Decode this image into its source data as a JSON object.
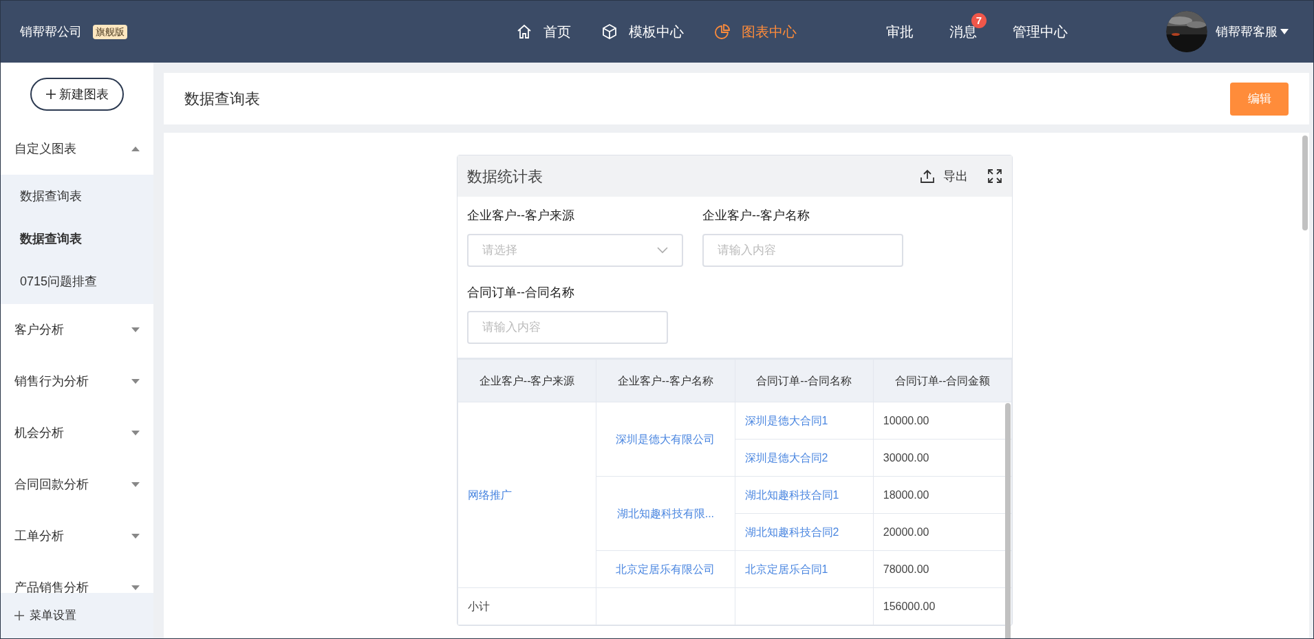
{
  "header": {
    "company": "销帮帮公司",
    "edition_badge": "旗舰版",
    "nav": [
      {
        "label": "首页",
        "selected": false
      },
      {
        "label": "模板中心",
        "selected": false
      },
      {
        "label": "图表中心",
        "selected": true
      }
    ],
    "links": [
      {
        "label": "审批"
      },
      {
        "label": "消息",
        "badge": "7"
      },
      {
        "label": "管理中心"
      }
    ],
    "user": {
      "name": "销帮帮客服"
    }
  },
  "sidebar": {
    "new_button": "新建图表",
    "groups": [
      {
        "label": "自定义图表",
        "expanded": true,
        "children": [
          {
            "label": "数据查询表",
            "selected": false
          },
          {
            "label": "数据查询表",
            "selected": true
          },
          {
            "label": "0715问题排查",
            "selected": false
          }
        ]
      },
      {
        "label": "客户分析",
        "expanded": false
      },
      {
        "label": "销售行为分析",
        "expanded": false
      },
      {
        "label": "机会分析",
        "expanded": false
      },
      {
        "label": "合同回款分析",
        "expanded": false
      },
      {
        "label": "工单分析",
        "expanded": false
      },
      {
        "label": "产品销售分析",
        "expanded": false
      }
    ],
    "footer": "菜单设置"
  },
  "page": {
    "title": "数据查询表",
    "edit_button": "编辑"
  },
  "widget": {
    "title": "数据统计表",
    "export": "导出",
    "filters": [
      {
        "label": "企业客户--客户来源",
        "kind": "select",
        "placeholder": "请选择"
      },
      {
        "label": "企业客户--客户名称",
        "kind": "text",
        "placeholder": "请输入内容"
      },
      {
        "label": "合同订单--合同名称",
        "kind": "text",
        "placeholder": "请输入内容"
      }
    ],
    "table": {
      "columns": [
        "企业客户--客户来源",
        "企业客户--客户名称",
        "合同订单--合同名称",
        "合同订单--合同金额"
      ],
      "groups": [
        {
          "source": "网络推广",
          "customers": [
            {
              "name": "深圳是德大有限公司",
              "contracts": [
                {
                  "name": "深圳是德大合同1",
                  "amount": "10000.00"
                },
                {
                  "name": "深圳是德大合同2",
                  "amount": "30000.00"
                }
              ]
            },
            {
              "name": "湖北知趣科技有限...",
              "contracts": [
                {
                  "name": "湖北知趣科技合同1",
                  "amount": "18000.00"
                },
                {
                  "name": "湖北知趣科技合同2",
                  "amount": "20000.00"
                }
              ]
            },
            {
              "name": "北京定居乐有限公司",
              "contracts": [
                {
                  "name": "北京定居乐合同1",
                  "amount": "78000.00"
                }
              ]
            }
          ]
        }
      ],
      "subtotal": {
        "label": "小计",
        "amount": "156000.00"
      }
    }
  }
}
